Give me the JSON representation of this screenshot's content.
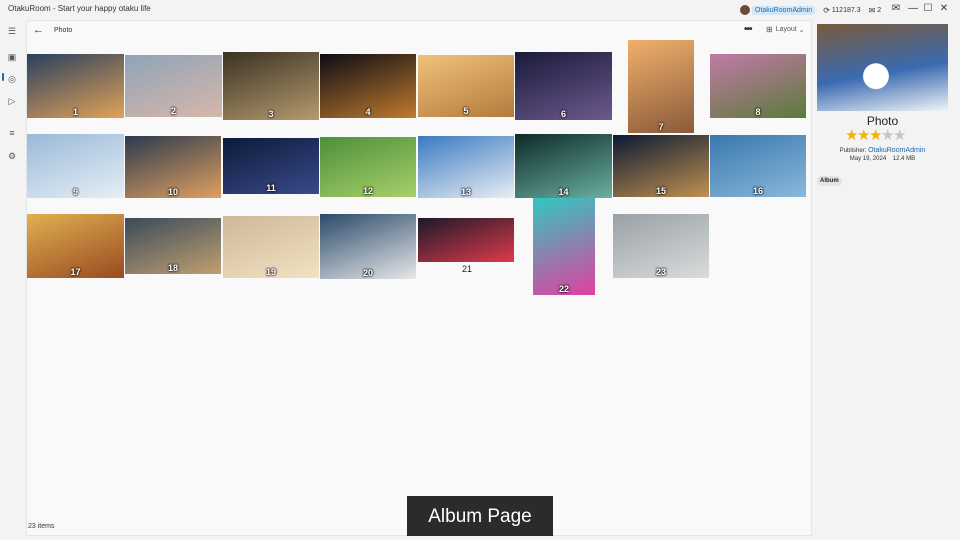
{
  "window": {
    "title": "OtakuRoom - Start your happy otaku life"
  },
  "account": {
    "name": "OtakuRoomAdmin",
    "points": "112187.3",
    "messages": "2"
  },
  "icons": {
    "coin": "coin-icon",
    "message": "message-icon",
    "mail": "mail-icon",
    "minimize": "minimize-icon",
    "maximize": "maximize-icon",
    "close": "close-icon",
    "menu": "hamburger-menu-icon",
    "photo": "photo-icon",
    "globe": "globe-icon",
    "play": "play-icon",
    "list": "list-icon",
    "settings": "gear-icon",
    "back": "back-arrow-icon",
    "more": "more-icon",
    "layout": "layout-icon",
    "star": "star-icon"
  },
  "header": {
    "title": "Photo",
    "layout_label": "Layout"
  },
  "album": {
    "items": [
      {
        "label": "1",
        "c1": "#29405f",
        "c2": "#e2a258"
      },
      {
        "label": "2",
        "c1": "#8fa4b8",
        "c2": "#d7b7a9"
      },
      {
        "label": "3",
        "c1": "#3a3224",
        "c2": "#b59b6e"
      },
      {
        "label": "4",
        "c1": "#0c0c14",
        "c2": "#c07b2e"
      },
      {
        "label": "5",
        "c1": "#f1c27a",
        "c2": "#b37a3c"
      },
      {
        "label": "6",
        "c1": "#1a1a3a",
        "c2": "#6c5a8e"
      },
      {
        "label": "7",
        "c1": "#f0b06a",
        "c2": "#8a5a3c"
      },
      {
        "label": "8",
        "c1": "#c27aa6",
        "c2": "#5b7a3c"
      },
      {
        "label": "9",
        "c1": "#9ab9d8",
        "c2": "#e6eef5"
      },
      {
        "label": "10",
        "c1": "#2b3a4e",
        "c2": "#e0a060"
      },
      {
        "label": "11",
        "c1": "#0d1a3a",
        "c2": "#3a4a8a"
      },
      {
        "label": "12",
        "c1": "#4c8f3a",
        "c2": "#a8d06a"
      },
      {
        "label": "13",
        "c1": "#3a7ac2",
        "c2": "#e8eef3"
      },
      {
        "label": "14",
        "c1": "#0d2a2a",
        "c2": "#6ab0a0"
      },
      {
        "label": "15",
        "c1": "#0b1a33",
        "c2": "#c09050"
      },
      {
        "label": "16",
        "c1": "#3a78b0",
        "c2": "#8ab8d8"
      },
      {
        "label": "17",
        "c1": "#e0b050",
        "c2": "#9a4a22"
      },
      {
        "label": "18",
        "c1": "#3a4a5a",
        "c2": "#c0a070"
      },
      {
        "label": "19",
        "c1": "#cdb89a",
        "c2": "#f2e2c2"
      },
      {
        "label": "20",
        "c1": "#2a4a6a",
        "c2": "#e8e8e8"
      },
      {
        "label": "21",
        "c1": "#1a1a2a",
        "c2": "#e03a4a"
      },
      {
        "label": "22",
        "c1": "#30c8c0",
        "c2": "#e040a0"
      },
      {
        "label": "23",
        "c1": "#9aa0a4",
        "c2": "#d8dcdc"
      }
    ],
    "count_text": "23 items"
  },
  "banner": {
    "text": "Album Page"
  },
  "details": {
    "title": "Photo",
    "rating": 3,
    "max_rating": 5,
    "publisher_label": "Publisher:",
    "publisher": "OtakuRoomAdmin",
    "date": "May 19, 2024",
    "size": "12.4 MB",
    "tag": "Album",
    "preview_colors": [
      "#7a5a3a",
      "#3a6ab0",
      "#f0f4f8"
    ]
  },
  "colors": {
    "accent": "#1a6bb0",
    "star_on": "#f5b400",
    "star_off": "#c4c4c4"
  }
}
